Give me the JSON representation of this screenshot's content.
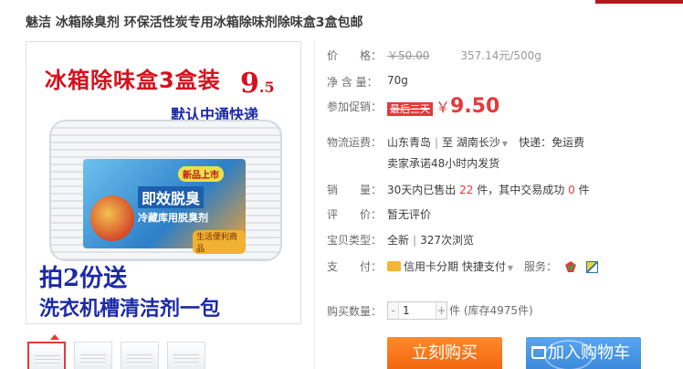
{
  "product": {
    "title": "魅洁 冰箱除臭剂 环保活性炭专用冰箱除味剂除味盒3盒包邮"
  },
  "main_image": {
    "promo_headline": "冰箱除味盒3盒装",
    "promo_price_int": "9",
    "promo_price_dec": ".5",
    "promo_shipping": "默认中通快递",
    "label_new": "新品上市",
    "label_title": "即效脱臭",
    "label_sub": "冷藏库用脱臭剂",
    "label_tag": "生活便利商品",
    "gift_line1": "拍2份送",
    "gift_line2": "洗衣机槽清洁剂一包"
  },
  "thumbnails": [
    "thumb-1",
    "thumb-2",
    "thumb-3",
    "thumb-4"
  ],
  "price": {
    "label": "价　　格：",
    "original": "￥50.00",
    "unit_price": "357.14元/500g"
  },
  "net_weight": {
    "label": "净 含 量：",
    "value": "70g"
  },
  "promotion": {
    "label": "参加促销：",
    "tag": "最后三天",
    "currency": "￥",
    "price": "9.50"
  },
  "shipping": {
    "label": "物流运费：",
    "from": "山东青岛",
    "sep": "|",
    "to_prefix": "至",
    "to": "湖南长沙",
    "fee": "快递：免运费",
    "promise": "卖家承诺48小时内发货"
  },
  "sales": {
    "label": "销　　量：",
    "prefix": "30天内已售出",
    "sold": "22",
    "mid": "件，其中交易成功",
    "success": "0",
    "suffix": "件"
  },
  "reviews": {
    "label": "评　　价：",
    "value": "暂无评价"
  },
  "item_type": {
    "label": "宝贝类型：",
    "value": "全新",
    "sep": "|",
    "views": "327次浏览"
  },
  "payment": {
    "label": "支　　付：",
    "credit": "信用卡分期",
    "quick": "快捷支付",
    "service_label": "服务："
  },
  "quantity": {
    "label": "购买数量：",
    "minus": "-",
    "value": "1",
    "plus": "+",
    "stock": "件 (库存4975件)"
  },
  "buttons": {
    "buy_now": "立刻购买",
    "add_to_cart": "加入购物车"
  },
  "colors": {
    "accent_red": "#e4393c",
    "buy_orange": "#f0620d",
    "cart_blue": "#3786dc"
  }
}
